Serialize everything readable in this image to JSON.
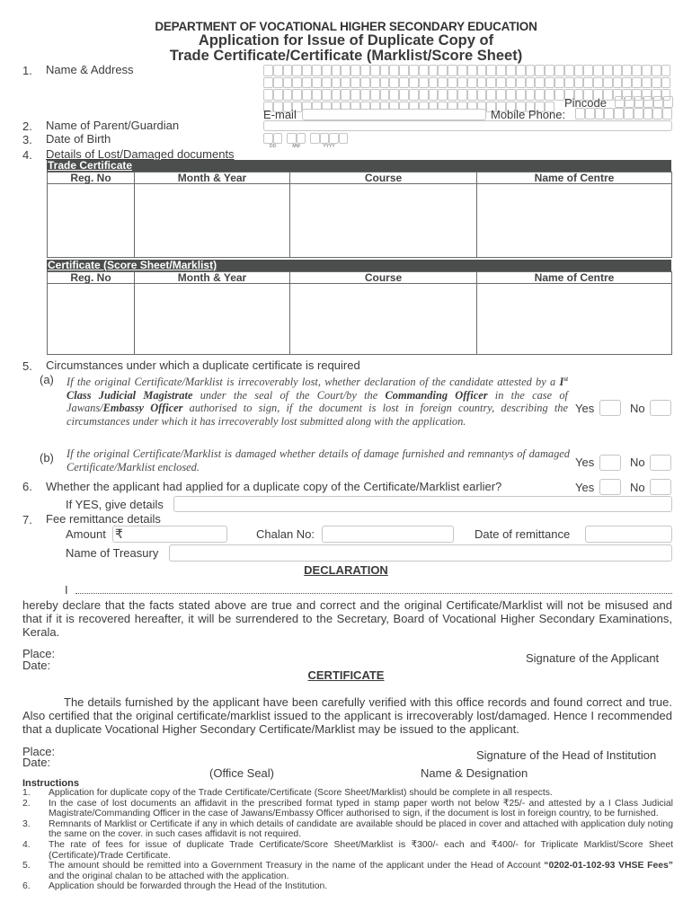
{
  "header": {
    "department": "DEPARTMENT OF VOCATIONAL HIGHER SECONDARY EDUCATION",
    "title_line1": "Application for Issue of Duplicate Copy of",
    "title_line2": "Trade Certificate/Certificate (Marklist/Score Sheet)"
  },
  "section1": {
    "number": "1.",
    "label": "Name & Address",
    "address_rows": 4,
    "boxes_per_row": 42,
    "last_row_boxes": 30,
    "pincode_label": "Pincode",
    "pincode_boxes": 6,
    "email_label": "E-mail",
    "email_value": "",
    "mobile_label": "Mobile Phone:",
    "mobile_boxes": 10
  },
  "section2": {
    "number": "2.",
    "label": "Name of Parent/Guardian",
    "value": ""
  },
  "section3": {
    "number": "3.",
    "label": "Date of Birth",
    "parts": [
      {
        "label": "DD",
        "boxes": 2
      },
      {
        "label": "MM",
        "boxes": 2
      },
      {
        "label": "YYYY",
        "boxes": 4
      }
    ]
  },
  "section4": {
    "number": "4.",
    "label": "Details of Lost/Damaged documents",
    "tables": [
      {
        "title": "Trade Certificate",
        "columns": [
          "Reg. No",
          "Month & Year",
          "Course",
          "Name of Centre"
        ],
        "rows": [
          [
            "",
            "",
            "",
            ""
          ]
        ]
      },
      {
        "title": "Certificate (Score Sheet/Marklist)",
        "columns": [
          "Reg. No",
          "Month & Year",
          "Course",
          "Name of Centre"
        ],
        "rows": [
          [
            "",
            "",
            "",
            ""
          ]
        ]
      }
    ]
  },
  "section5": {
    "number": "5.",
    "label": "Circumstances under which a duplicate certificate is required",
    "a": {
      "marker": "(a)",
      "text_parts": [
        {
          "t": "If the original Certificate/Marklist is irrecoverably lost, whether declaration of the candidate attested by a ",
          "b": false
        },
        {
          "t": "I",
          "b": true
        },
        {
          "t": "st",
          "b": true,
          "sup": true
        },
        {
          "t": " Class Judicial Magistrate",
          "b": true
        },
        {
          "t": " under the seal of the Court/by the ",
          "b": false
        },
        {
          "t": "Commanding Officer",
          "b": true
        },
        {
          "t": " in the case of Jawans/",
          "b": false
        },
        {
          "t": "Embassy Officer",
          "b": true
        },
        {
          "t": " authorised to sign, if the document is lost in foreign country, describing the circumstances under which it has irrecoverably lost submitted along with the application.",
          "b": false
        }
      ],
      "yes_label": "Yes",
      "no_label": "No",
      "yes_checked": false,
      "no_checked": false
    },
    "b": {
      "marker": "(b)",
      "text": "If the original Certificate/Marklist is damaged whether details of damage furnished and remnantys of damaged Certificate/Marklist enclosed.",
      "yes_label": "Yes",
      "no_label": "No",
      "yes_checked": false,
      "no_checked": false
    }
  },
  "section6": {
    "number": "6.",
    "label": "Whether the applicant had applied for a duplicate copy of the Certificate/Marklist earlier?",
    "yes_label": "Yes",
    "no_label": "No",
    "yes_checked": false,
    "no_checked": false,
    "details_label": "If YES, give details",
    "details_value": ""
  },
  "section7": {
    "number": "7.",
    "label": "Fee remittance details",
    "amount_label": "Amount",
    "currency_symbol": "₹",
    "amount_value": "",
    "chalan_label": "Chalan No:",
    "chalan_value": "",
    "date_label": "Date of remittance",
    "date_value": "",
    "treasury_label": "Name of Treasury",
    "treasury_value": ""
  },
  "declaration": {
    "heading": "DECLARATION",
    "line_prefix": "I",
    "text": "hereby declare that the facts stated above are true and correct and the original Certificate/Marklist will not be misused and that if it is recovered hereafter, it will be surrendered to the Secretary, Board of Vocational Higher Secondary Examinations, Kerala.",
    "place_label": "Place:",
    "date_label": "Date:",
    "signature_label": "Signature of the Applicant"
  },
  "certificate": {
    "heading": "CERTIFICATE",
    "text": "The details furnished by the applicant have been carefully verified with this office records and found correct and true.  Also certified that the original certificate/marklist issued to the applicant is irrecoverably lost/damaged.  Hence I recommended that a duplicate Vocational Higher Secondary Certificate/Marklist may be issued to the applicant.",
    "place_label": "Place:",
    "date_label": "Date:",
    "signature_label": "Signature of the Head of Institution",
    "seal_label": "(Office Seal)",
    "name_designation_label": "Name & Designation"
  },
  "instructions": {
    "heading": "Instructions",
    "items": [
      {
        "num": "1.",
        "text": "Application for duplicate copy of the Trade Certificate/Certificate (Score Sheet/Marklist) should be complete in all respects."
      },
      {
        "num": "2.",
        "text": "In the case of lost documents an affidavit in the prescribed format typed in stamp paper worth not below ₹25/- and attested by a I Class Judicial Magistrate/Commanding Officer in the case of Jawans/Embassy Officer authorised to sign, if the document is lost in foreign country, to be furnished."
      },
      {
        "num": "3.",
        "text": "Remnants of Marklist or Certificate if any in which details of candidate are available should be placed in cover and attached with application duly noting the same on the cover.  in such cases affidavit is not required."
      },
      {
        "num": "4.",
        "text": "The rate of fees for issue of duplicate Trade Certificate/Score Sheet/Marklist is ₹300/- each and ₹400/- for Triplicate Marklist/Score Sheet (Certificate)/Trade Certificate."
      },
      {
        "num": "5.",
        "text_parts": [
          {
            "t": "The amount should be remitted into a Government Treasury in the name of the applicant under the Head of Account ",
            "b": false
          },
          {
            "t": "“0202-01-102-93 VHSE Fees”",
            "b": true
          },
          {
            "t": " and the original chalan to be attached with the application.",
            "b": false
          }
        ]
      },
      {
        "num": "6.",
        "text": "Application should be forwarded through the Head of the Institution."
      }
    ]
  }
}
